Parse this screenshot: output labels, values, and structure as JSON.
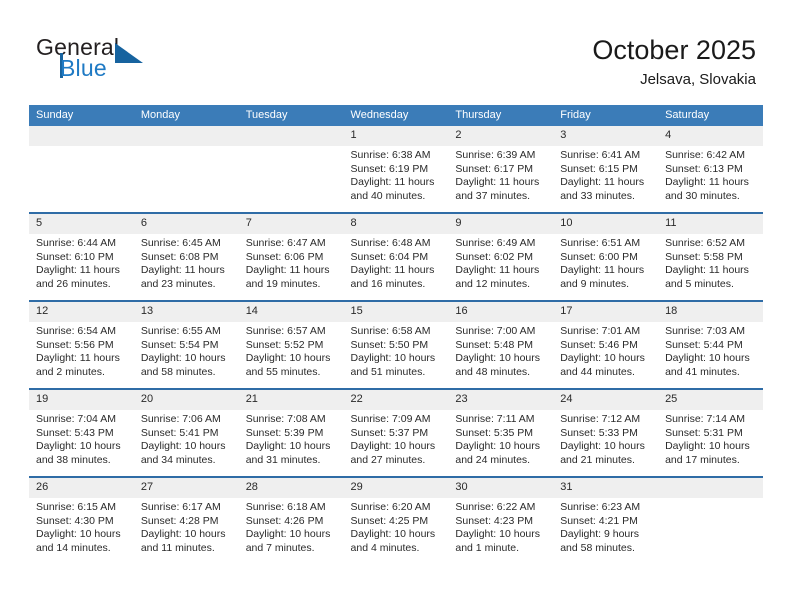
{
  "brand": {
    "word1": "General",
    "word2": "Blue",
    "logo_icon": "triangle-flag-icon",
    "accent_color": "#1f7ac4",
    "dark_color": "#17639f"
  },
  "header": {
    "title": "October 2025",
    "location": "Jelsava, Slovakia"
  },
  "theme": {
    "header_row_bg": "#3b7cb8",
    "row_divider": "#2f6ca6",
    "daynum_bg": "#efefef"
  },
  "weekday_headers": [
    "Sunday",
    "Monday",
    "Tuesday",
    "Wednesday",
    "Thursday",
    "Friday",
    "Saturday"
  ],
  "weeks": [
    [
      {
        "day": "",
        "empty": true
      },
      {
        "day": "",
        "empty": true
      },
      {
        "day": "",
        "empty": true
      },
      {
        "day": "1",
        "sunrise": "Sunrise: 6:38 AM",
        "sunset": "Sunset: 6:19 PM",
        "daylight1": "Daylight: 11 hours",
        "daylight2": "and 40 minutes."
      },
      {
        "day": "2",
        "sunrise": "Sunrise: 6:39 AM",
        "sunset": "Sunset: 6:17 PM",
        "daylight1": "Daylight: 11 hours",
        "daylight2": "and 37 minutes."
      },
      {
        "day": "3",
        "sunrise": "Sunrise: 6:41 AM",
        "sunset": "Sunset: 6:15 PM",
        "daylight1": "Daylight: 11 hours",
        "daylight2": "and 33 minutes."
      },
      {
        "day": "4",
        "sunrise": "Sunrise: 6:42 AM",
        "sunset": "Sunset: 6:13 PM",
        "daylight1": "Daylight: 11 hours",
        "daylight2": "and 30 minutes."
      }
    ],
    [
      {
        "day": "5",
        "sunrise": "Sunrise: 6:44 AM",
        "sunset": "Sunset: 6:10 PM",
        "daylight1": "Daylight: 11 hours",
        "daylight2": "and 26 minutes."
      },
      {
        "day": "6",
        "sunrise": "Sunrise: 6:45 AM",
        "sunset": "Sunset: 6:08 PM",
        "daylight1": "Daylight: 11 hours",
        "daylight2": "and 23 minutes."
      },
      {
        "day": "7",
        "sunrise": "Sunrise: 6:47 AM",
        "sunset": "Sunset: 6:06 PM",
        "daylight1": "Daylight: 11 hours",
        "daylight2": "and 19 minutes."
      },
      {
        "day": "8",
        "sunrise": "Sunrise: 6:48 AM",
        "sunset": "Sunset: 6:04 PM",
        "daylight1": "Daylight: 11 hours",
        "daylight2": "and 16 minutes."
      },
      {
        "day": "9",
        "sunrise": "Sunrise: 6:49 AM",
        "sunset": "Sunset: 6:02 PM",
        "daylight1": "Daylight: 11 hours",
        "daylight2": "and 12 minutes."
      },
      {
        "day": "10",
        "sunrise": "Sunrise: 6:51 AM",
        "sunset": "Sunset: 6:00 PM",
        "daylight1": "Daylight: 11 hours",
        "daylight2": "and 9 minutes."
      },
      {
        "day": "11",
        "sunrise": "Sunrise: 6:52 AM",
        "sunset": "Sunset: 5:58 PM",
        "daylight1": "Daylight: 11 hours",
        "daylight2": "and 5 minutes."
      }
    ],
    [
      {
        "day": "12",
        "sunrise": "Sunrise: 6:54 AM",
        "sunset": "Sunset: 5:56 PM",
        "daylight1": "Daylight: 11 hours",
        "daylight2": "and 2 minutes."
      },
      {
        "day": "13",
        "sunrise": "Sunrise: 6:55 AM",
        "sunset": "Sunset: 5:54 PM",
        "daylight1": "Daylight: 10 hours",
        "daylight2": "and 58 minutes."
      },
      {
        "day": "14",
        "sunrise": "Sunrise: 6:57 AM",
        "sunset": "Sunset: 5:52 PM",
        "daylight1": "Daylight: 10 hours",
        "daylight2": "and 55 minutes."
      },
      {
        "day": "15",
        "sunrise": "Sunrise: 6:58 AM",
        "sunset": "Sunset: 5:50 PM",
        "daylight1": "Daylight: 10 hours",
        "daylight2": "and 51 minutes."
      },
      {
        "day": "16",
        "sunrise": "Sunrise: 7:00 AM",
        "sunset": "Sunset: 5:48 PM",
        "daylight1": "Daylight: 10 hours",
        "daylight2": "and 48 minutes."
      },
      {
        "day": "17",
        "sunrise": "Sunrise: 7:01 AM",
        "sunset": "Sunset: 5:46 PM",
        "daylight1": "Daylight: 10 hours",
        "daylight2": "and 44 minutes."
      },
      {
        "day": "18",
        "sunrise": "Sunrise: 7:03 AM",
        "sunset": "Sunset: 5:44 PM",
        "daylight1": "Daylight: 10 hours",
        "daylight2": "and 41 minutes."
      }
    ],
    [
      {
        "day": "19",
        "sunrise": "Sunrise: 7:04 AM",
        "sunset": "Sunset: 5:43 PM",
        "daylight1": "Daylight: 10 hours",
        "daylight2": "and 38 minutes."
      },
      {
        "day": "20",
        "sunrise": "Sunrise: 7:06 AM",
        "sunset": "Sunset: 5:41 PM",
        "daylight1": "Daylight: 10 hours",
        "daylight2": "and 34 minutes."
      },
      {
        "day": "21",
        "sunrise": "Sunrise: 7:08 AM",
        "sunset": "Sunset: 5:39 PM",
        "daylight1": "Daylight: 10 hours",
        "daylight2": "and 31 minutes."
      },
      {
        "day": "22",
        "sunrise": "Sunrise: 7:09 AM",
        "sunset": "Sunset: 5:37 PM",
        "daylight1": "Daylight: 10 hours",
        "daylight2": "and 27 minutes."
      },
      {
        "day": "23",
        "sunrise": "Sunrise: 7:11 AM",
        "sunset": "Sunset: 5:35 PM",
        "daylight1": "Daylight: 10 hours",
        "daylight2": "and 24 minutes."
      },
      {
        "day": "24",
        "sunrise": "Sunrise: 7:12 AM",
        "sunset": "Sunset: 5:33 PM",
        "daylight1": "Daylight: 10 hours",
        "daylight2": "and 21 minutes."
      },
      {
        "day": "25",
        "sunrise": "Sunrise: 7:14 AM",
        "sunset": "Sunset: 5:31 PM",
        "daylight1": "Daylight: 10 hours",
        "daylight2": "and 17 minutes."
      }
    ],
    [
      {
        "day": "26",
        "sunrise": "Sunrise: 6:15 AM",
        "sunset": "Sunset: 4:30 PM",
        "daylight1": "Daylight: 10 hours",
        "daylight2": "and 14 minutes."
      },
      {
        "day": "27",
        "sunrise": "Sunrise: 6:17 AM",
        "sunset": "Sunset: 4:28 PM",
        "daylight1": "Daylight: 10 hours",
        "daylight2": "and 11 minutes."
      },
      {
        "day": "28",
        "sunrise": "Sunrise: 6:18 AM",
        "sunset": "Sunset: 4:26 PM",
        "daylight1": "Daylight: 10 hours",
        "daylight2": "and 7 minutes."
      },
      {
        "day": "29",
        "sunrise": "Sunrise: 6:20 AM",
        "sunset": "Sunset: 4:25 PM",
        "daylight1": "Daylight: 10 hours",
        "daylight2": "and 4 minutes."
      },
      {
        "day": "30",
        "sunrise": "Sunrise: 6:22 AM",
        "sunset": "Sunset: 4:23 PM",
        "daylight1": "Daylight: 10 hours",
        "daylight2": "and 1 minute."
      },
      {
        "day": "31",
        "sunrise": "Sunrise: 6:23 AM",
        "sunset": "Sunset: 4:21 PM",
        "daylight1": "Daylight: 9 hours",
        "daylight2": "and 58 minutes."
      },
      {
        "day": "",
        "empty": true
      }
    ]
  ]
}
